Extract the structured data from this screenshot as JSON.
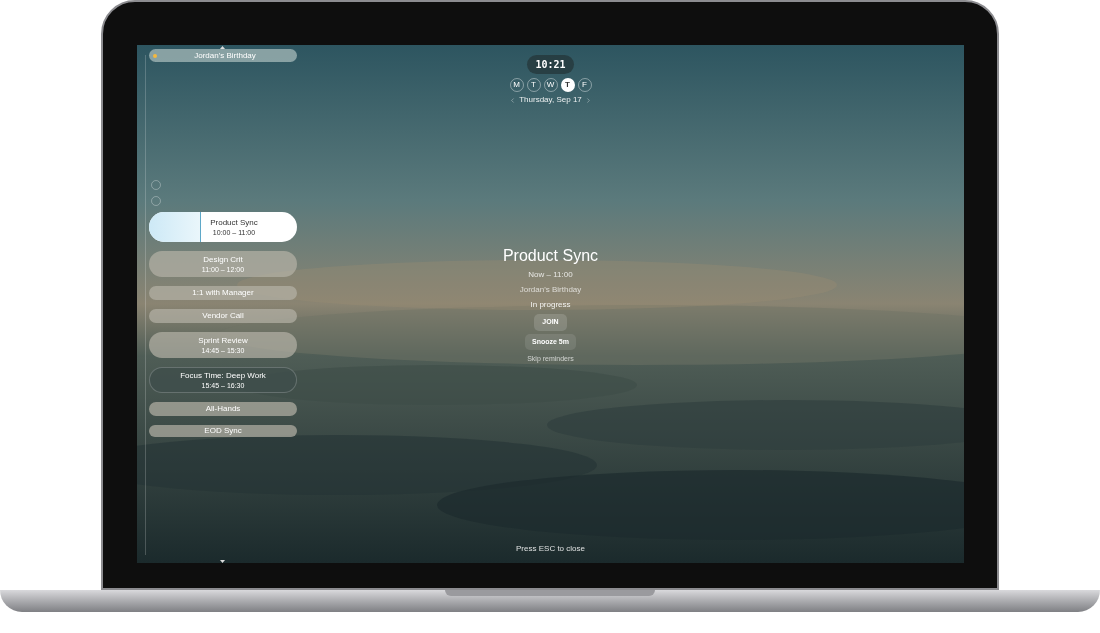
{
  "agenda": {
    "all_day": {
      "title": "Jordan's Birthday",
      "color": "#f5b83d"
    },
    "events": [
      {
        "title": "Product Sync",
        "time": "10:00 – 11:00",
        "kind": "timed",
        "selected": true,
        "level": 0.35
      },
      {
        "title": "Design Crit",
        "time": "11:00 – 12:00",
        "kind": "timed",
        "selected": false
      },
      {
        "title": "1:1 with Manager",
        "kind": "short",
        "selected": false
      },
      {
        "title": "Vendor Call",
        "kind": "short",
        "selected": false
      },
      {
        "title": "Sprint Review",
        "time": "14:45 – 15:30",
        "kind": "timed",
        "selected": false
      },
      {
        "title": "Focus Time: Deep Work",
        "time": "15:45 – 16:30",
        "kind": "focus",
        "selected": false
      },
      {
        "title": "All-Hands",
        "kind": "short",
        "selected": false
      },
      {
        "title": "EOD Sync",
        "kind": "thin",
        "selected": false
      }
    ]
  },
  "clock": "10:21",
  "weekdays": [
    {
      "label": "M",
      "selected": false
    },
    {
      "label": "T",
      "selected": false
    },
    {
      "label": "W",
      "selected": false
    },
    {
      "label": "T",
      "selected": true
    },
    {
      "label": "F",
      "selected": false
    }
  ],
  "date": "Thursday, Sep 17",
  "focus": {
    "title": "Product Sync",
    "time": "Now – 11:00",
    "note": "Jordan's Birthday",
    "status": "In progress",
    "primary": "JOIN",
    "secondary": "Snooze 5m",
    "link": "Skip reminders"
  },
  "footer": "Press ESC to close"
}
